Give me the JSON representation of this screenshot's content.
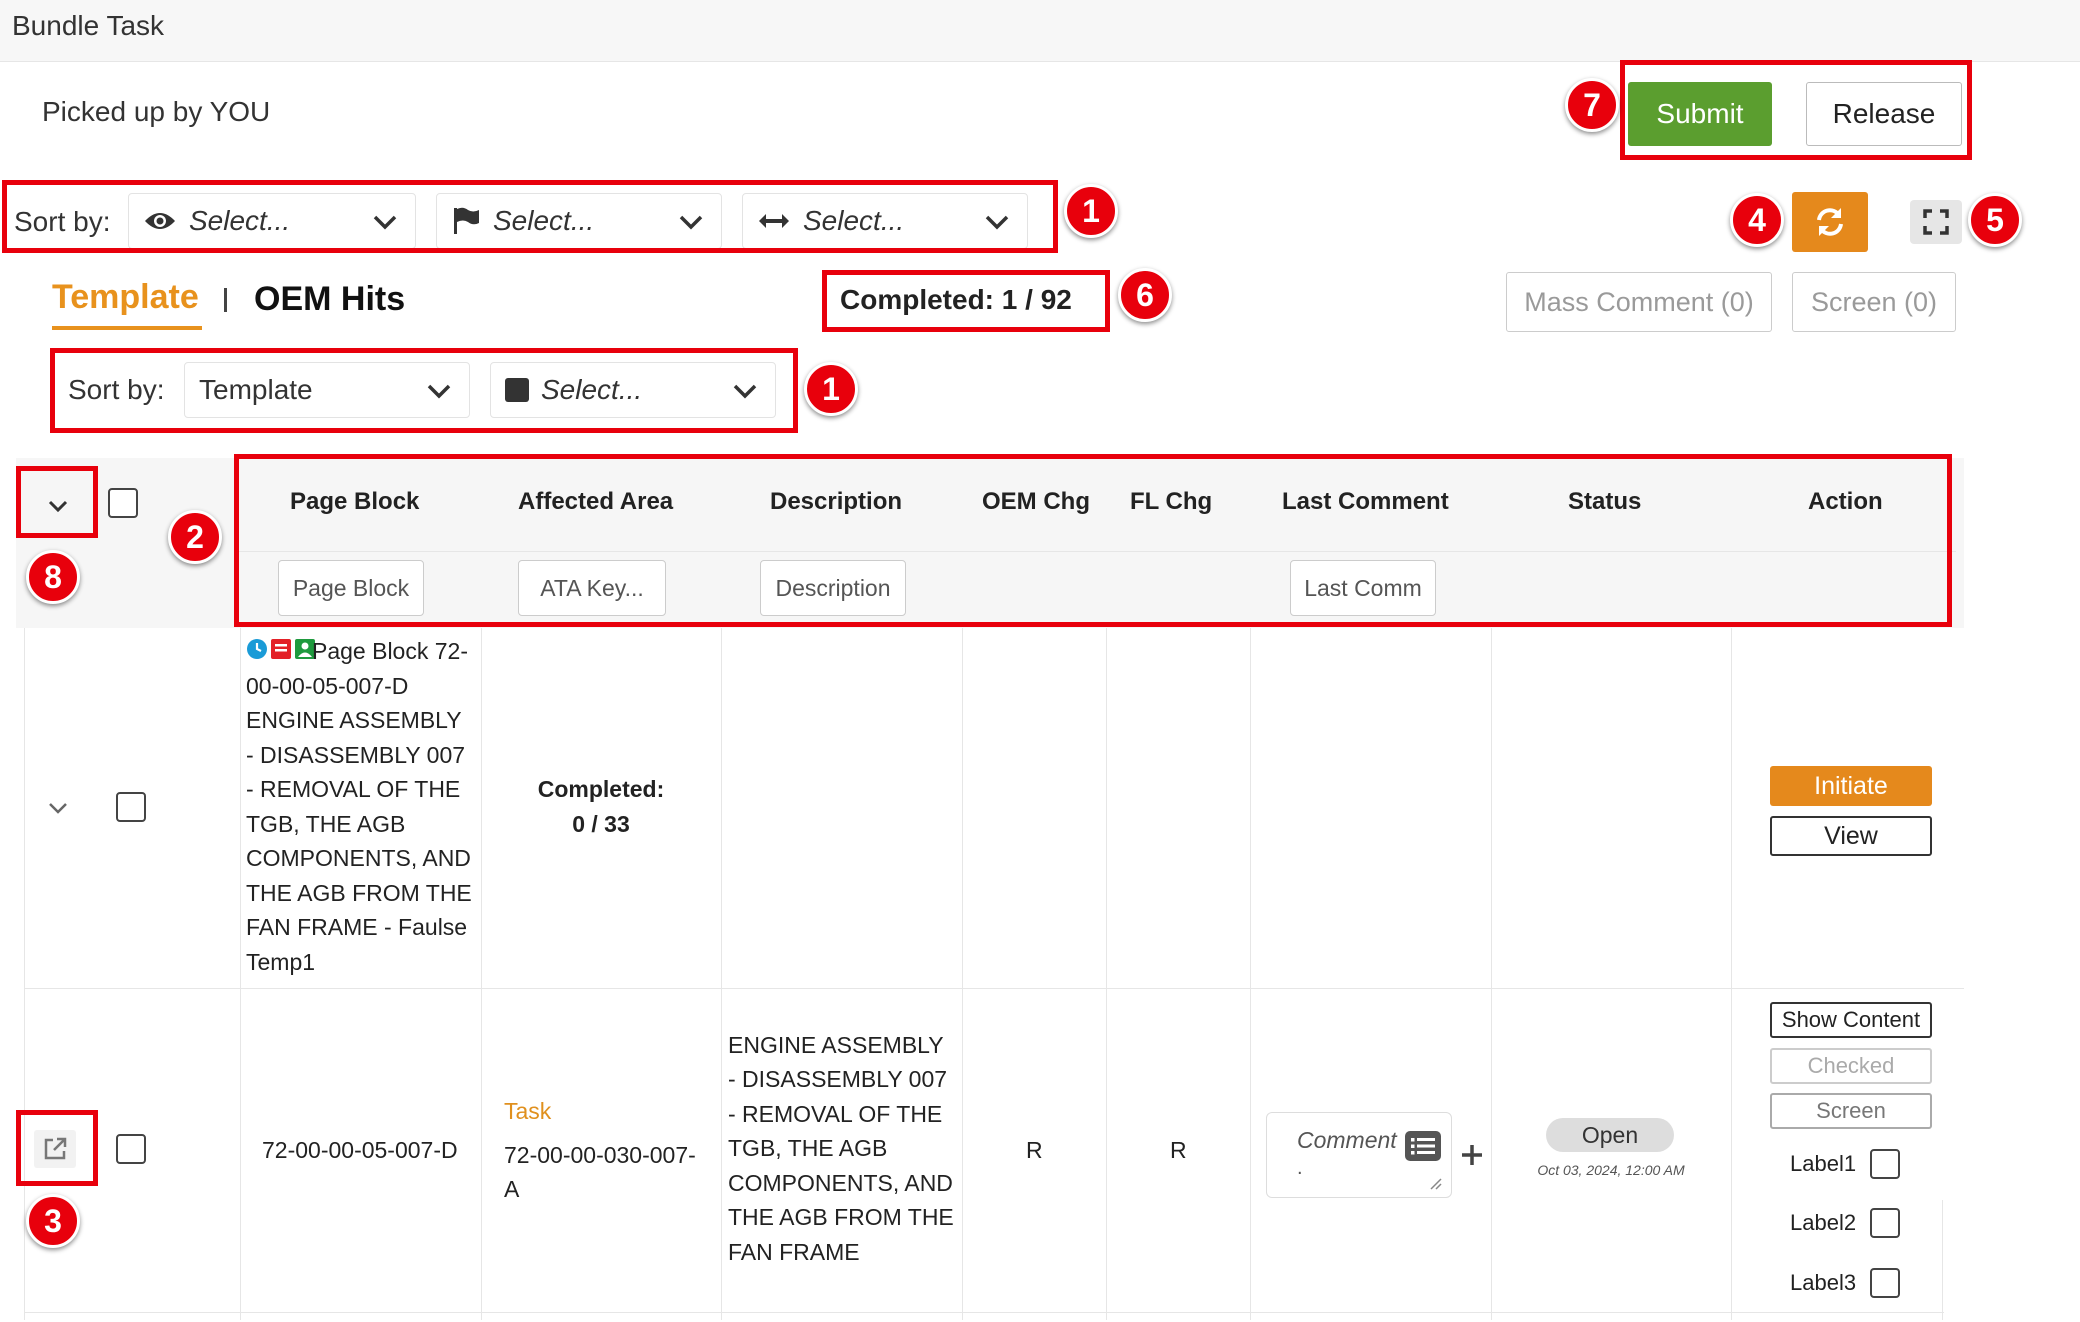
{
  "app": {
    "title": "Bundle Task",
    "picked_up": "Picked up by YOU"
  },
  "actions": {
    "submit": "Submit",
    "release": "Release"
  },
  "sort_top": {
    "label": "Sort by:",
    "selects": [
      {
        "icon": "eye-icon",
        "placeholder": "Select..."
      },
      {
        "icon": "flag-icon",
        "placeholder": "Select..."
      },
      {
        "icon": "arrows-horizontal-icon",
        "placeholder": "Select..."
      }
    ]
  },
  "tabs": {
    "template": "Template",
    "oem_hits": "OEM Hits"
  },
  "completed": "Completed: 1 / 92",
  "toolbar": {
    "mass_comment": "Mass Comment (0)",
    "screen": "Screen (0)"
  },
  "sort_second": {
    "label": "Sort by:",
    "value": "Template",
    "placeholder": "Select..."
  },
  "table": {
    "headers": [
      "Page Block",
      "Affected Area",
      "Description",
      "OEM Chg",
      "FL Chg",
      "Last Comment",
      "Status",
      "Action"
    ],
    "filters": {
      "page_block": "Page Block",
      "affected_area": "ATA Key...",
      "description": "Description",
      "last_comment": "Last Comm"
    },
    "group_row": {
      "page_block_lines": [
        "Page Block 72-",
        "00-00-05-007-D",
        "ENGINE ASSEMBLY",
        "- DISASSEMBLY 007",
        "- REMOVAL OF THE",
        "TGB, THE AGB",
        "COMPONENTS, AND",
        "THE AGB FROM THE",
        "FAN FRAME - Faulse",
        "Temp1"
      ],
      "completed_label": "Completed:",
      "completed_value": "0 / 33",
      "initiate": "Initiate",
      "view": "View"
    },
    "task_row": {
      "page_block": "72-00-00-05-007-D",
      "affected_area_type": "Task",
      "affected_area_code_lines": [
        "72-00-00-030-007-",
        "A"
      ],
      "description_lines": [
        "ENGINE ASSEMBLY",
        "- DISASSEMBLY 007",
        "- REMOVAL OF THE",
        "TGB, THE AGB",
        "COMPONENTS, AND",
        "THE AGB FROM THE",
        "FAN FRAME"
      ],
      "oem_chg": "R",
      "fl_chg": "R",
      "comment_placeholder": "Comment",
      "comment_dot": ".",
      "status": "Open",
      "status_date": "Oct 03, 2024, 12:00 AM",
      "show_content": "Show Content",
      "checked": "Checked",
      "screen": "Screen",
      "labels": [
        "Label1",
        "Label2",
        "Label3"
      ]
    }
  },
  "callouts": [
    "1",
    "1",
    "2",
    "3",
    "4",
    "5",
    "6",
    "7",
    "8"
  ],
  "colors": {
    "accent_orange": "#e5891c",
    "submit_green": "#5b9e2f",
    "callout_red": "#e8000c",
    "tab_active": "#e8921d"
  }
}
